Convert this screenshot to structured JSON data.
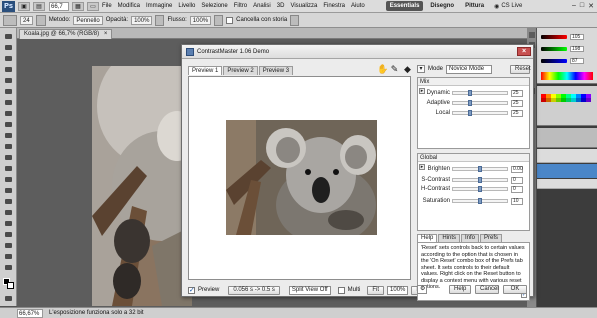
{
  "menubar": {
    "logo": "Ps",
    "zoom": "66,7",
    "items": [
      "File",
      "Modifica",
      "Immagine",
      "Livello",
      "Selezione",
      "Filtro",
      "Analisi",
      "3D",
      "Visualizza",
      "Finestra",
      "Aiuto"
    ],
    "workspaces": [
      "Essentials",
      "Disegno",
      "Pittura"
    ],
    "cs_live": "CS Live"
  },
  "options_bar": {
    "size": "24",
    "method_label": "Metodo:",
    "method_value": "Pennello",
    "opacity_label": "Opacità:",
    "opacity_value": "100%",
    "flow_label": "Flusso:",
    "flow_value": "100%",
    "history_label": "Cancella con storia"
  },
  "document": {
    "tab_title": "Koala.jpg @ 66,7% (RGB/8)"
  },
  "status": {
    "zoom": "66,67%",
    "message": "L'esposizione funziona solo a 32 bit"
  },
  "right_panel": {
    "color_values": [
      "105",
      "198",
      "87"
    ]
  },
  "dialog": {
    "title": "ContrastMaster 1.06 Demo",
    "preview_tabs": [
      "Preview 1",
      "Preview 2",
      "Preview 3"
    ],
    "tool_icons": [
      "hand-icon",
      "eyedropper-icon",
      "target-icon"
    ],
    "mode_label": "Mode",
    "mode_value": "Novice Mode",
    "reset_label": "Reset",
    "mix": {
      "title": "Mix",
      "sliders": [
        {
          "name": "Dynamic",
          "value": "25",
          "pos": 0.3
        },
        {
          "name": "Adaptive",
          "value": "25",
          "pos": 0.3
        },
        {
          "name": "Local",
          "value": "25",
          "pos": 0.3
        }
      ]
    },
    "global": {
      "title": "Global",
      "sliders": [
        {
          "name": "Brighten",
          "value": "0.00",
          "pos": 0.5
        },
        {
          "name": "S-Contrast",
          "value": "0",
          "pos": 0.5
        },
        {
          "name": "H-Contrast",
          "value": "0",
          "pos": 0.5
        },
        {
          "name": "Saturation",
          "value": "10",
          "pos": 0.5
        }
      ]
    },
    "help_tabs": [
      "Help",
      "Hints",
      "Info",
      "Prefs"
    ],
    "help_text": "'Reset' sets controls back to certain values according to the option that is chosen in the 'On Reset' combo box of the Prefs tab sheet. It sets controls to their default values. Right click on the Reset button to display a context menu with various reset options.",
    "bottom": {
      "preview_label": "Preview",
      "time_label": "0.056 s -> 0.5 s",
      "split_view": "Split View Off",
      "multi_label": "Multi",
      "fit_label": "Fit",
      "zoom_value": "100%",
      "fit2_label": "Fit"
    },
    "footer": {
      "help_label": "Help",
      "cancel_label": "Cancel",
      "ok_label": "OK"
    }
  }
}
